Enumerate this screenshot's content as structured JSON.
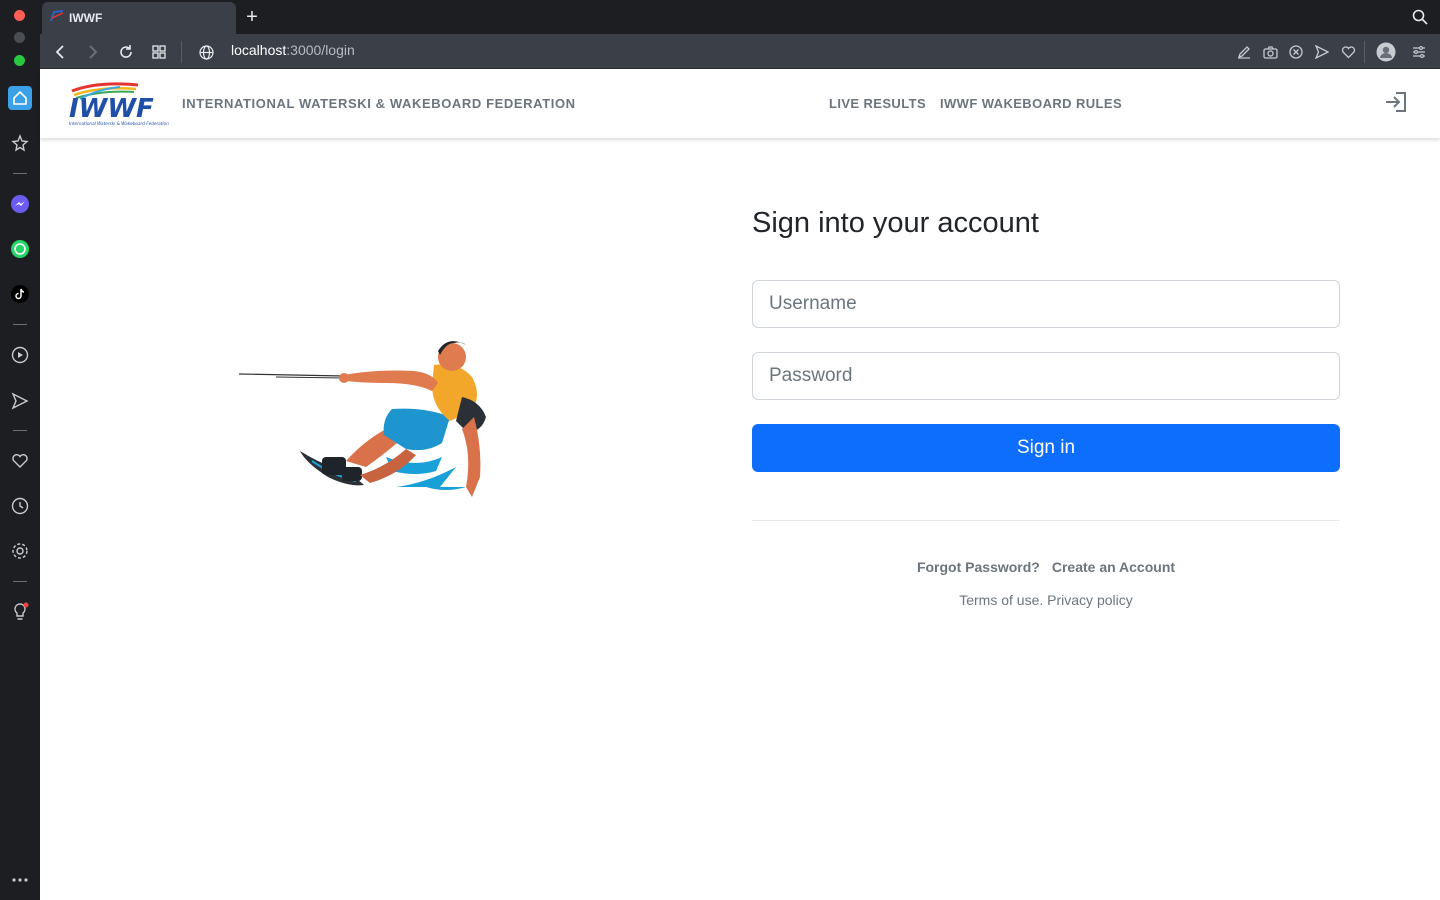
{
  "browser": {
    "tab_title": "IWWF",
    "new_tab": "+",
    "url_host": "localhost",
    "url_path": ":3000/login"
  },
  "header": {
    "brand_name": "INTERNATIONAL WATERSKI & WAKEBOARD FEDERATION",
    "logo_text": "IWWF",
    "logo_caption": "International Waterski & Wakeboard Federation",
    "nav": [
      {
        "label": "LIVE RESULTS"
      },
      {
        "label": "IWWF WAKEBOARD RULES"
      }
    ]
  },
  "login": {
    "title": "Sign into your account",
    "username_placeholder": "Username",
    "password_placeholder": "Password",
    "submit_label": "Sign in",
    "forgot_label": "Forgot Password?",
    "create_label": "Create an Account",
    "terms_label": "Terms of use.",
    "privacy_label": "Privacy policy"
  },
  "colors": {
    "primary": "#0d6efd",
    "muted_text": "#6c757d",
    "browser_chrome": "#3a3f48",
    "sidebar": "#1c1e22"
  }
}
